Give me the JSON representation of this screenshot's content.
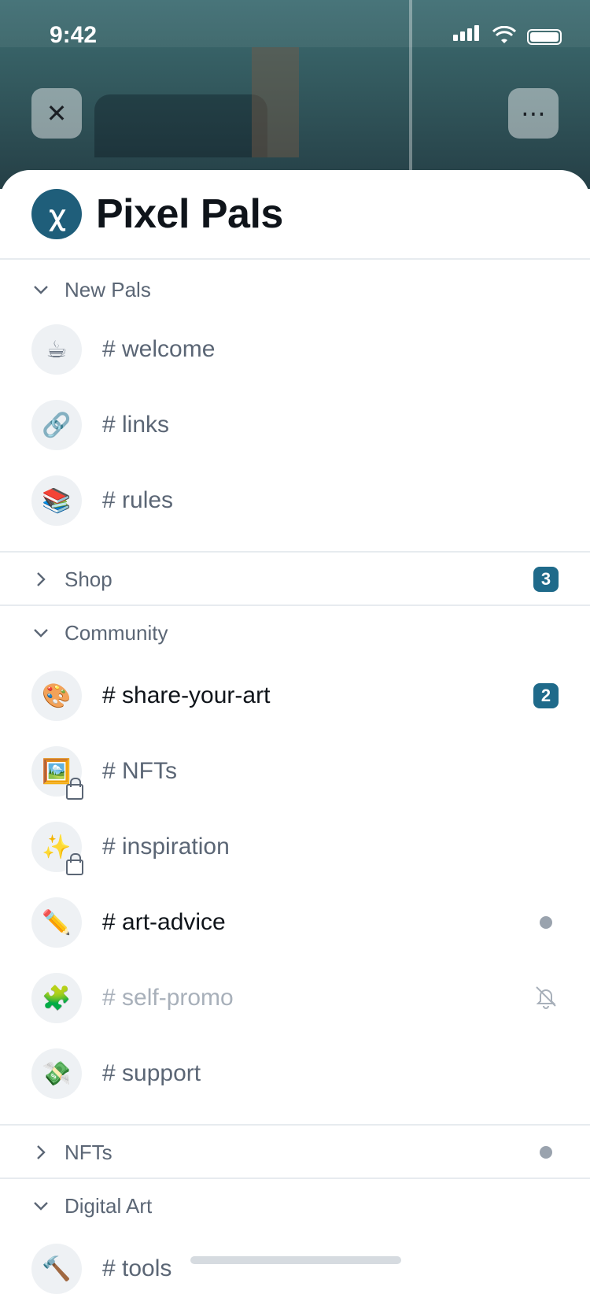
{
  "status": {
    "time": "9:42"
  },
  "banner": {
    "close_icon": "close-icon",
    "more_icon": "more-icon"
  },
  "server": {
    "name": "Pixel Pals",
    "avatar_icon": "logo-icon"
  },
  "sections": [
    {
      "title": "New Pals",
      "expanded": true,
      "channels": [
        {
          "name": "# welcome",
          "emoji": "☕"
        },
        {
          "name": "# links",
          "emoji": "🔗"
        },
        {
          "name": "# rules",
          "emoji": "📚"
        }
      ]
    },
    {
      "title": "Shop",
      "expanded": false,
      "badge": "3"
    },
    {
      "title": "Community",
      "expanded": true,
      "channels": [
        {
          "name": "# share-your-art",
          "emoji": "🎨",
          "badge": "2",
          "style": "strong"
        },
        {
          "name": "# NFTs",
          "emoji": "🖼️",
          "locked": true
        },
        {
          "name": "# inspiration",
          "emoji": "✨",
          "locked": true
        },
        {
          "name": "# art-advice",
          "emoji": "✏️",
          "style": "strong",
          "dot": true
        },
        {
          "name": "# self-promo",
          "emoji": "🧩",
          "style": "muted",
          "muted_icon": "bell-off-icon"
        },
        {
          "name": "# support",
          "emoji": "💸"
        }
      ]
    },
    {
      "title": "NFTs",
      "expanded": false,
      "dot": true
    },
    {
      "title": "Digital Art",
      "expanded": true,
      "channels": [
        {
          "name": "# tools",
          "emoji": "🔨"
        }
      ]
    }
  ]
}
